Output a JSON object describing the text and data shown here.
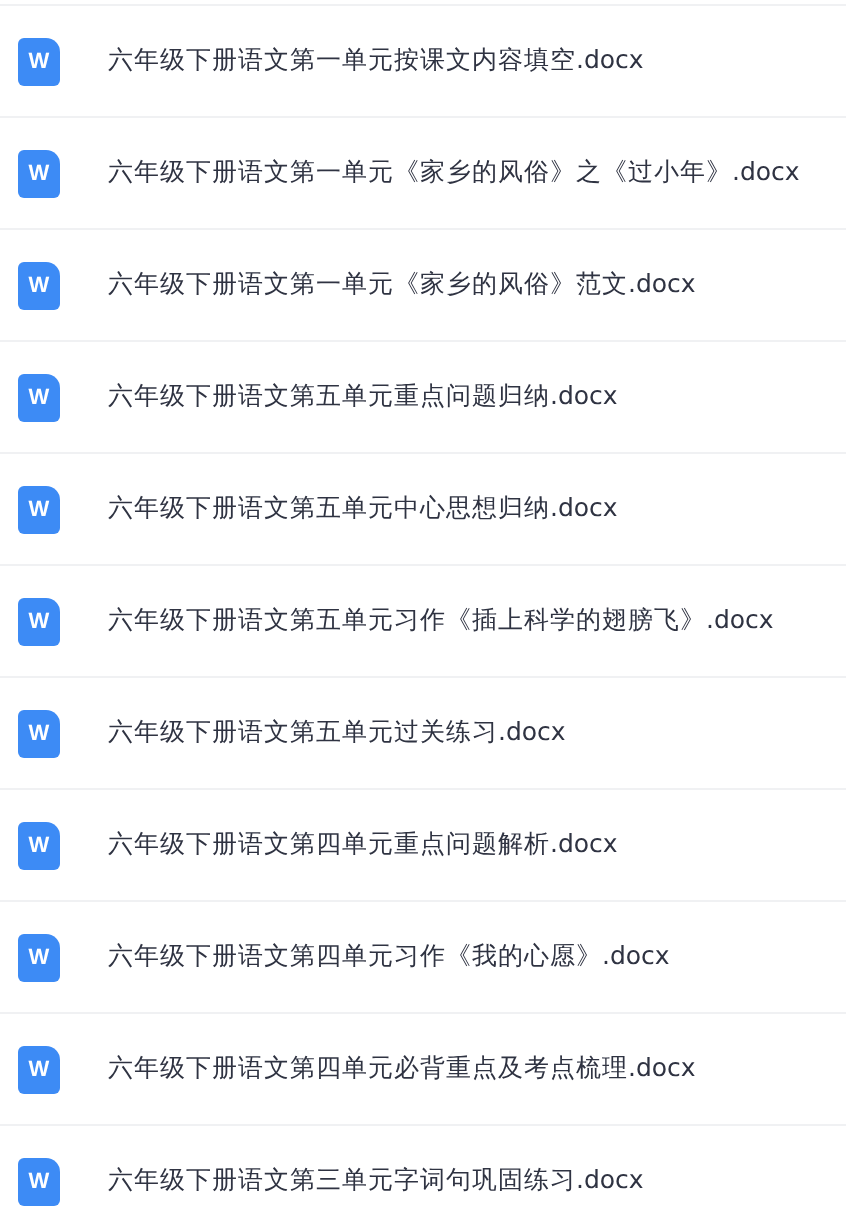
{
  "files": [
    {
      "icon_text": "W",
      "name": "六年级下册语文第一单元按课文内容填空.docx"
    },
    {
      "icon_text": "W",
      "name": "六年级下册语文第一单元《家乡的风俗》之《过小年》.docx"
    },
    {
      "icon_text": "W",
      "name": "六年级下册语文第一单元《家乡的风俗》范文.docx"
    },
    {
      "icon_text": "W",
      "name": "六年级下册语文第五单元重点问题归纳.docx"
    },
    {
      "icon_text": "W",
      "name": "六年级下册语文第五单元中心思想归纳.docx"
    },
    {
      "icon_text": "W",
      "name": "六年级下册语文第五单元习作《插上科学的翅膀飞》.docx"
    },
    {
      "icon_text": "W",
      "name": "六年级下册语文第五单元过关练习.docx"
    },
    {
      "icon_text": "W",
      "name": "六年级下册语文第四单元重点问题解析.docx"
    },
    {
      "icon_text": "W",
      "name": "六年级下册语文第四单元习作《我的心愿》.docx"
    },
    {
      "icon_text": "W",
      "name": "六年级下册语文第四单元必背重点及考点梳理.docx"
    },
    {
      "icon_text": "W",
      "name": "六年级下册语文第三单元字词句巩固练习.docx"
    }
  ]
}
